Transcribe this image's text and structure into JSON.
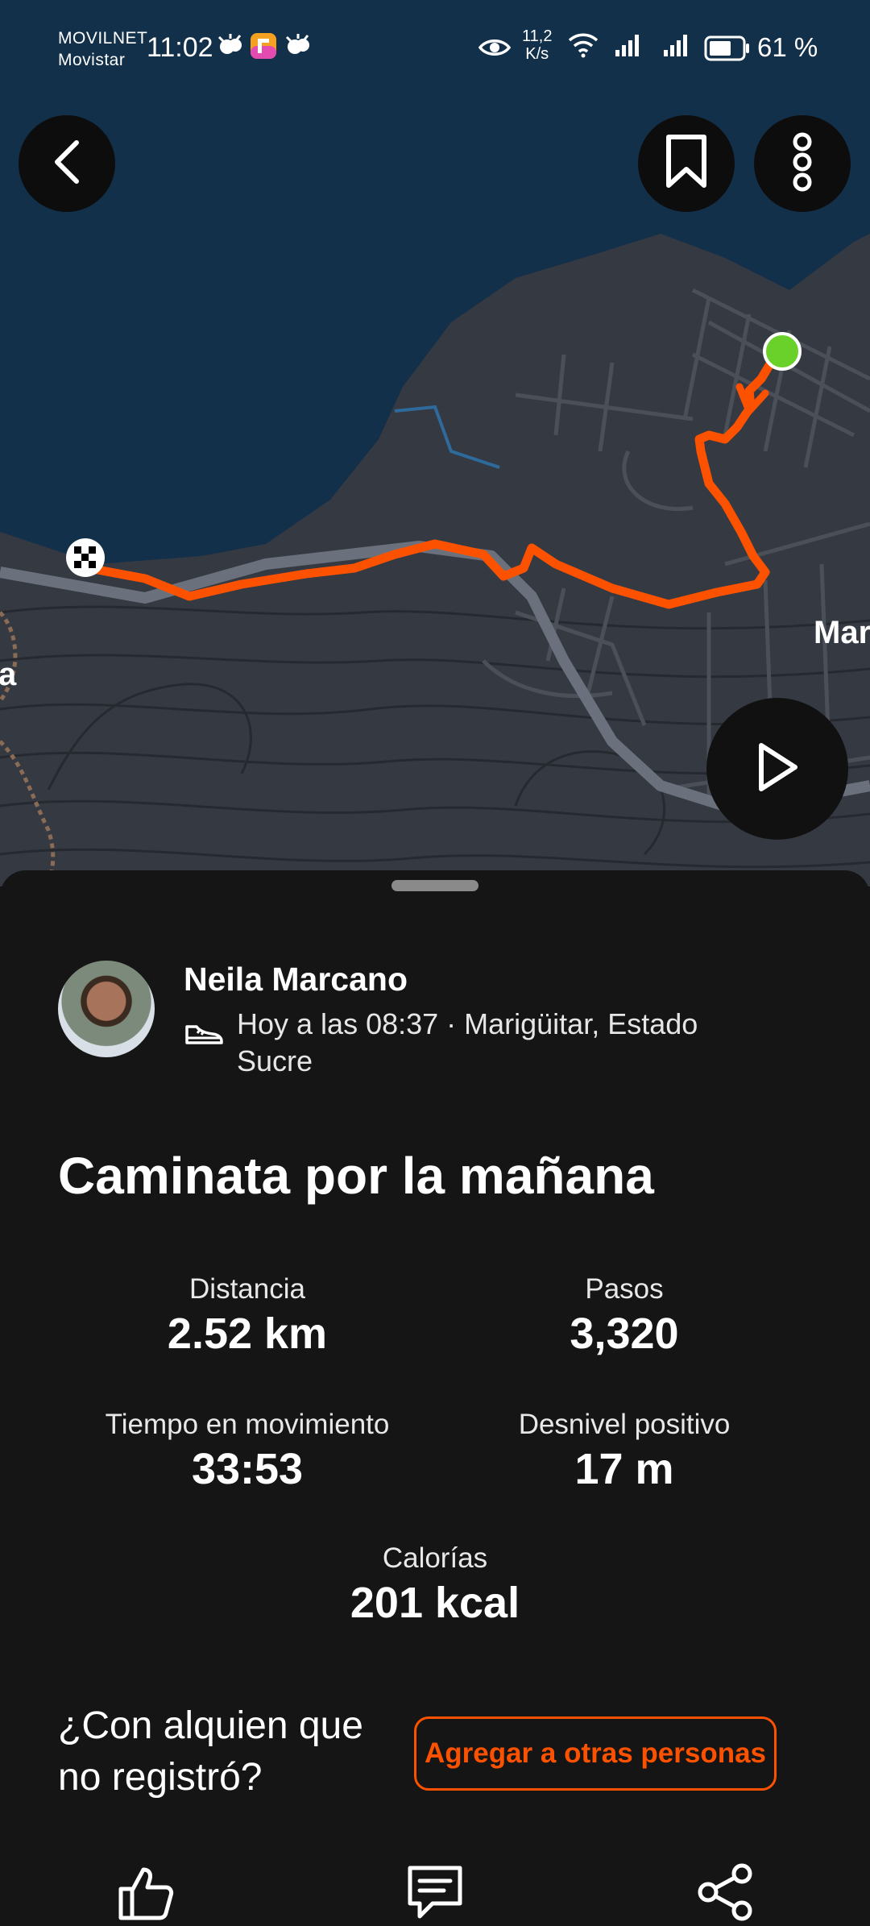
{
  "status_bar": {
    "carrier_top": "MOVILNET",
    "carrier_bottom": "Movistar",
    "time": "11:02",
    "net_speed_value": "11,2",
    "net_speed_unit": "K/s",
    "battery_percent": "61 %",
    "icons": [
      "weather-icon",
      "weather-icon",
      "app-notification-icon",
      "eye-icon",
      "wifi-icon",
      "signal-icon",
      "signal-icon",
      "battery-icon"
    ]
  },
  "map": {
    "place_label_right": "Mar",
    "place_label_left": "a",
    "route_color": "#fc5200",
    "start_marker_color": "#6ad12a",
    "water_color": "#13304a",
    "land_color": "#353942"
  },
  "header_buttons": {
    "back": "back-arrow-icon",
    "save": "bookmark-icon",
    "more": "more-vertical-icon"
  },
  "play": "play-icon",
  "athlete": {
    "name": "Neila Marcano",
    "meta": "Hoy a las 08:37 · Marigüitar, Estado Sucre",
    "activity_icon": "shoe-icon"
  },
  "activity": {
    "title": "Caminata por la mañana"
  },
  "stats": {
    "distance": {
      "label": "Distancia",
      "value": "2.52 km"
    },
    "steps": {
      "label": "Pasos",
      "value": "3,320"
    },
    "moving_time": {
      "label": "Tiempo en movimiento",
      "value": "33:53"
    },
    "elevation": {
      "label": "Desnivel positivo",
      "value": "17 m"
    },
    "calories": {
      "label": "Calorías",
      "value": "201 kcal"
    }
  },
  "tag_others": {
    "prompt_line1": "¿Con alquien que",
    "prompt_line2": "no registró?",
    "button_label": "Agregar a otras personas"
  },
  "actions": [
    "thumbs-up-icon",
    "comment-icon",
    "share-icon"
  ],
  "colors": {
    "accent": "#fc5200",
    "background": "#151515"
  }
}
